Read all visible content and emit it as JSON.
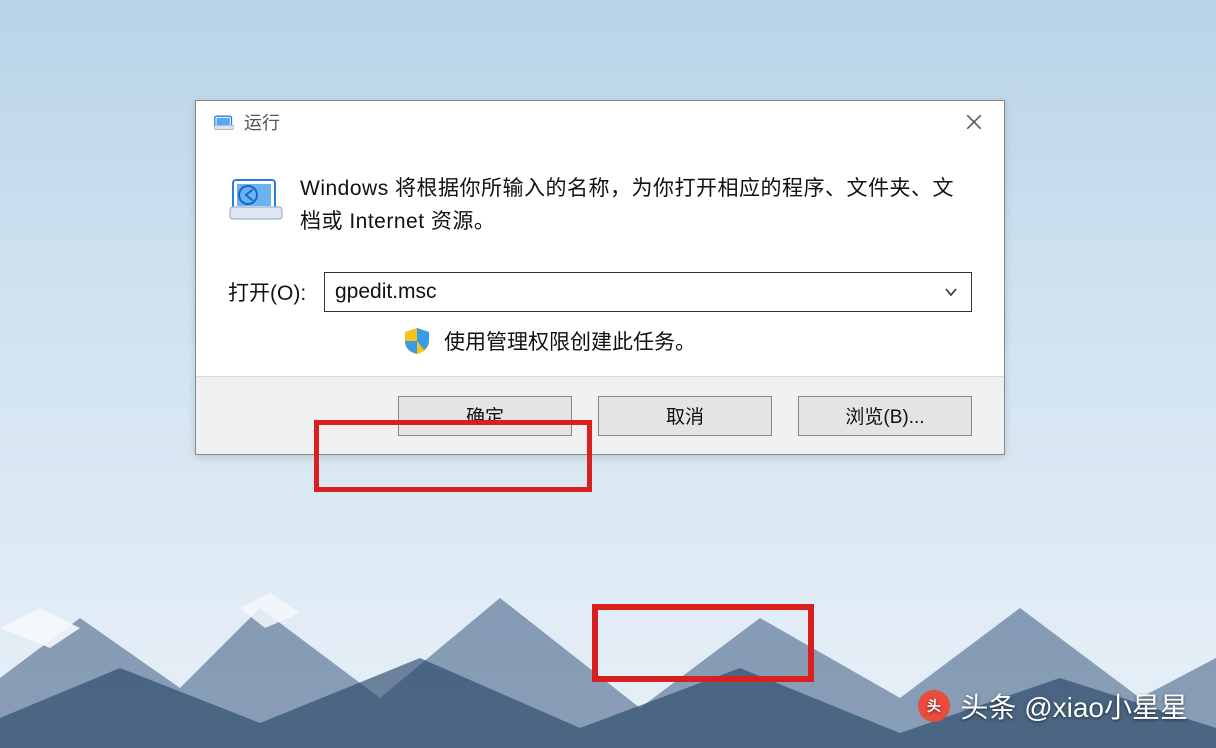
{
  "dialog": {
    "title": "运行",
    "description": "Windows 将根据你所输入的名称，为你打开相应的程序、文件夹、文档或 Internet 资源。",
    "open_label": "打开(O):",
    "command_value": "gpedit.msc",
    "note": "使用管理权限创建此任务。",
    "buttons": {
      "ok": "确定",
      "cancel": "取消",
      "browse": "浏览(B)..."
    }
  },
  "watermark": "头条 @xiao小星星"
}
